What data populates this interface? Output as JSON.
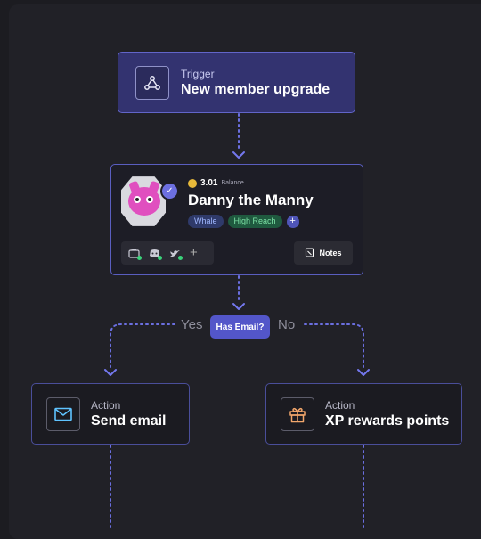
{
  "trigger": {
    "icon": "webhook-icon",
    "kicker": "Trigger",
    "title": "New member upgrade"
  },
  "member": {
    "balance_value": "3.01",
    "balance_label": "Balance",
    "name": "Danny the Manny",
    "tags": [
      "Whale",
      "High Reach"
    ],
    "add_tag": "+",
    "socials": [
      "wallet-icon",
      "discord-icon",
      "twitter-icon"
    ],
    "add_social": "+",
    "notes_label": "Notes",
    "verified": "✓"
  },
  "decision": {
    "label": "Has Email?",
    "yes_label": "Yes",
    "no_label": "No"
  },
  "actions": [
    {
      "icon": "mail-icon",
      "kicker": "Action",
      "title": "Send email"
    },
    {
      "icon": "gift-icon",
      "kicker": "Action",
      "title": "XP rewards points"
    }
  ],
  "colors": {
    "accent": "#5356c9",
    "wire": "#6b6fe0",
    "trigger_bg": "#333370",
    "card_border": "#5a5ec0"
  }
}
